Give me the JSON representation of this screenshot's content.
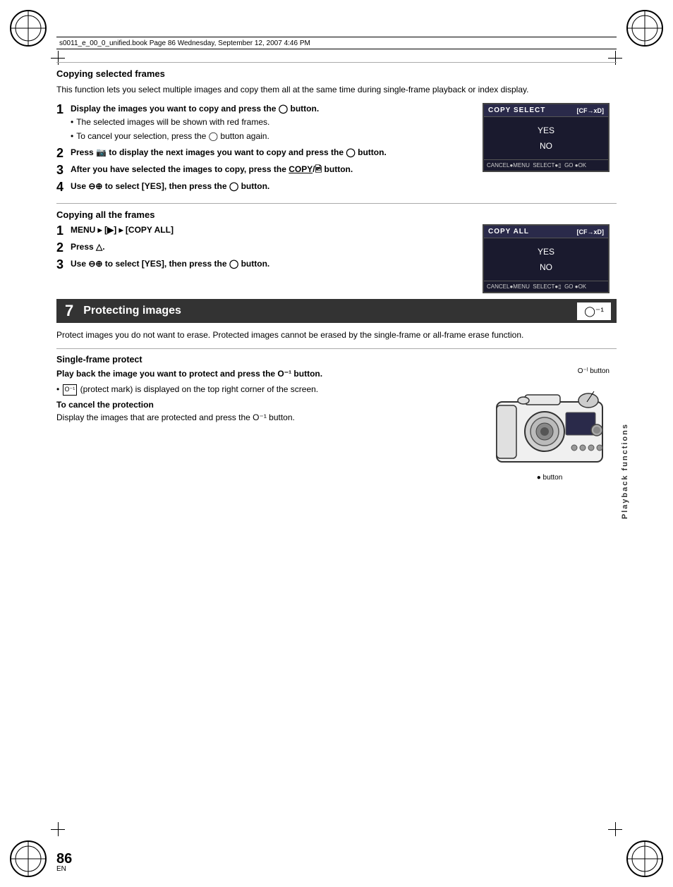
{
  "header": {
    "text": "s0011_e_00_0_unified.book  Page 86  Wednesday, September 12, 2007  4:46 PM"
  },
  "page_number": "86",
  "page_number_sub": "EN",
  "section_copy_selected": {
    "heading": "Copying selected frames",
    "intro": "This function lets you select multiple images and copy them all at the same time during single-frame playback or index display.",
    "steps": [
      {
        "num": "1",
        "text_bold": "Display the images you want to copy and press the  button.",
        "bullets": [
          "The selected images will be shown with red frames.",
          "To cancel your selection, press the  button again."
        ]
      },
      {
        "num": "2",
        "text_bold": "Press  to display the next images you want to copy and press the  button."
      },
      {
        "num": "3",
        "text_bold": "After you have selected the images to copy, press the COPY/ button."
      },
      {
        "num": "4",
        "text_bold": "Use  to select [YES], then press the  button."
      }
    ],
    "screen": {
      "title": "COPY SELECT",
      "subtitle": "[CF→xD]",
      "options": [
        "YES",
        "NO"
      ],
      "footer": "CANCEL●MENU  SELECT●  GO ●OK"
    }
  },
  "section_copy_all": {
    "heading": "Copying all the frames",
    "steps": [
      {
        "num": "1",
        "text": "MENU ▸ [▶] ▸ [COPY ALL]"
      },
      {
        "num": "2",
        "text": "Press ."
      },
      {
        "num": "3",
        "text": "Use  to select [YES], then press the  button."
      }
    ],
    "screen": {
      "title": "COPY ALL",
      "subtitle": "[CF→xD]",
      "options": [
        "YES",
        "NO"
      ],
      "footer": "CANCEL●MENU  SELECT●  GO ●OK"
    }
  },
  "section7": {
    "num": "7",
    "title": "Protecting images",
    "icon": "O⁻ˡ",
    "intro": "Protect images you do not want to erase. Protected images cannot be erased by the single-frame or all-frame erase function.",
    "single_frame": {
      "heading": "Single-frame protect",
      "play_instruction": "Play back the image you want to protect and press the O⁻ˡ button.",
      "bullet": "(protect mark) is displayed on the top right corner of the screen.",
      "cancel_heading": "To cancel the protection",
      "cancel_text": "Display the images that are protected and press the O⁻ˡ button.",
      "button_label_top": "O⁻ˡ button",
      "button_label_bottom": "● button"
    }
  },
  "playback_label": "Playback functions"
}
